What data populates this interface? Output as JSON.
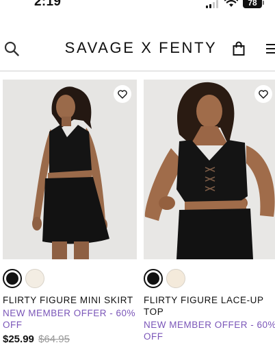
{
  "status_bar": {
    "time": "2:19",
    "battery": "78"
  },
  "header": {
    "brand": "SAVAGE X FENTY",
    "icons": [
      "search-icon",
      "bag-icon",
      "menu-icon"
    ]
  },
  "colors": {
    "offer_text": "#7a55b8",
    "divider": "#cfcfcf"
  },
  "products": [
    {
      "name": "FLIRTY FIGURE MINI SKIRT",
      "offer": "NEW MEMBER OFFER - 60% OFF",
      "price_now": "$25.99",
      "price_was": "$64.95",
      "swatches": [
        "black",
        "cream"
      ],
      "selected_swatch": "black"
    },
    {
      "name": "FLIRTY FIGURE LACE-UP TOP",
      "offer": "NEW MEMBER OFFER - 60% OFF",
      "swatches": [
        "black",
        "cream"
      ],
      "selected_swatch": "black"
    }
  ]
}
